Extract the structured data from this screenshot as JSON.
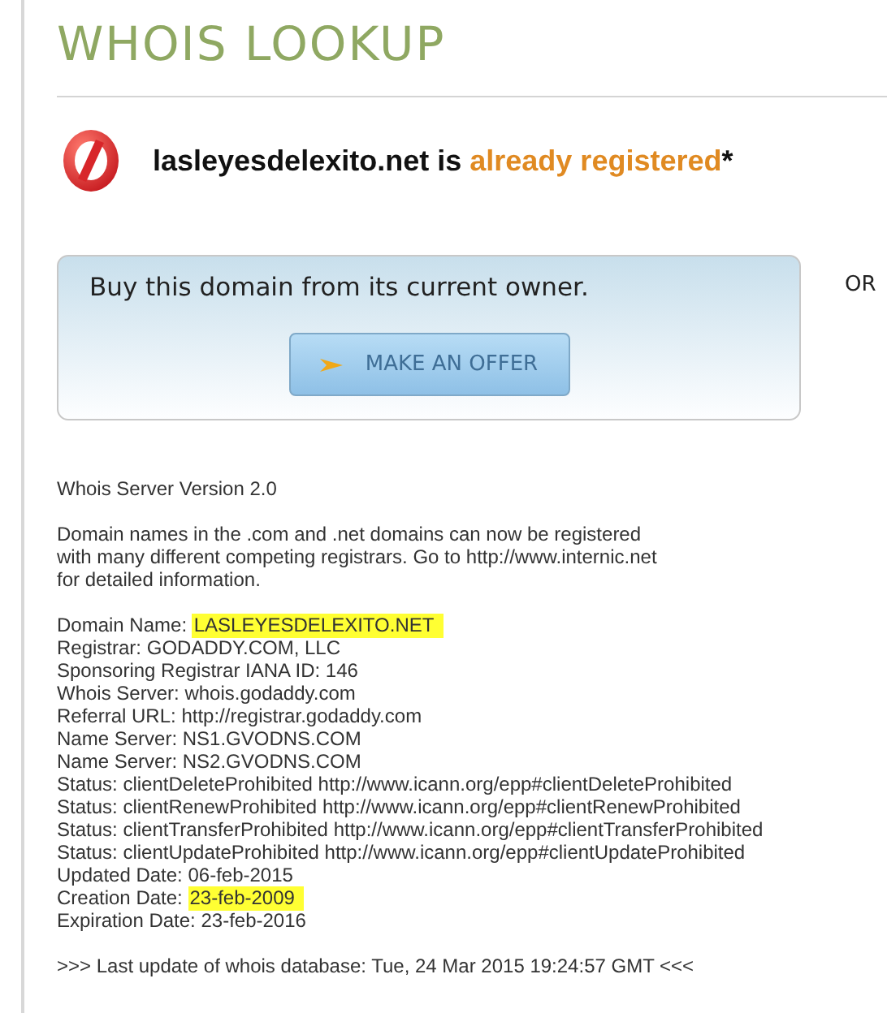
{
  "title": "WHOIS LOOKUP",
  "result": {
    "domain": "lasleyesdelexito.net",
    "connector": "is",
    "status": "already registered",
    "note_mark": "*"
  },
  "offer": {
    "text": "Buy this domain from its current owner.",
    "button": "MAKE AN OFFER"
  },
  "or_label": "OR",
  "whois": {
    "header": "Whois Server Version 2.0",
    "notice": "Domain names in the .com and .net domains can now be registered\nwith many different competing registrars. Go to http://www.internic.net\nfor detailed information.",
    "records": [
      {
        "label": "Domain Name:",
        "value": "LASLEYESDELEXITO.NET",
        "highlighted": true
      },
      {
        "label": "Registrar:",
        "value": "GODADDY.COM, LLC",
        "highlighted": false
      },
      {
        "label": "Sponsoring Registrar IANA ID:",
        "value": "146",
        "highlighted": false
      },
      {
        "label": "Whois Server:",
        "value": "whois.godaddy.com",
        "highlighted": false
      },
      {
        "label": "Referral URL:",
        "value": "http://registrar.godaddy.com",
        "highlighted": false
      },
      {
        "label": "Name Server:",
        "value": "NS1.GVODNS.COM",
        "highlighted": false
      },
      {
        "label": "Name Server:",
        "value": "NS2.GVODNS.COM",
        "highlighted": false
      },
      {
        "label": "Status:",
        "value": "clientDeleteProhibited http://www.icann.org/epp#clientDeleteProhibited",
        "highlighted": false
      },
      {
        "label": "Status:",
        "value": "clientRenewProhibited http://www.icann.org/epp#clientRenewProhibited",
        "highlighted": false
      },
      {
        "label": "Status:",
        "value": "clientTransferProhibited http://www.icann.org/epp#clientTransferProhibited",
        "highlighted": false
      },
      {
        "label": "Status:",
        "value": "clientUpdateProhibited http://www.icann.org/epp#clientUpdateProhibited",
        "highlighted": false
      },
      {
        "label": "Updated Date:",
        "value": "06-feb-2015",
        "highlighted": false
      },
      {
        "label": "Creation Date:",
        "value": "23-feb-2009",
        "highlighted": true
      },
      {
        "label": "Expiration Date:",
        "value": "23-feb-2016",
        "highlighted": false
      }
    ],
    "footer": ">>> Last update of whois database: Tue, 24 Mar 2015 19:24:57 GMT <<<"
  }
}
